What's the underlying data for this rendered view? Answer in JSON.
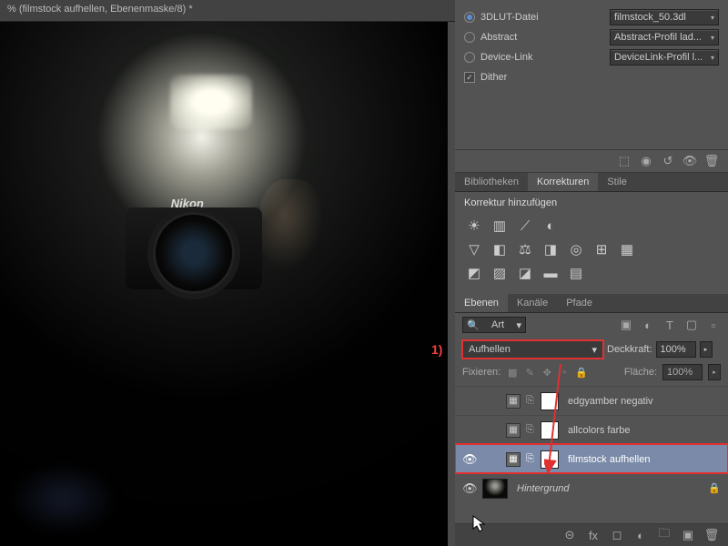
{
  "document": {
    "tab_title": "% (filmstock aufhellen, Ebenenmaske/8) *"
  },
  "camera_brand": "Nikon",
  "properties": {
    "lut": {
      "label": "3DLUT-Datei",
      "value": "filmstock_50.3dl"
    },
    "abstract": {
      "label": "Abstract",
      "value": "Abstract-Profil lad..."
    },
    "device": {
      "label": "Device-Link",
      "value": "DeviceLink-Profil l..."
    },
    "dither": {
      "label": "Dither",
      "checked": true
    }
  },
  "tabs_mid": {
    "bibliotheken": "Bibliotheken",
    "korrekturen": "Korrekturen",
    "stile": "Stile"
  },
  "adjustments": {
    "title": "Korrektur hinzufügen"
  },
  "tabs_layers": {
    "ebenen": "Ebenen",
    "kanaele": "Kanäle",
    "pfade": "Pfade"
  },
  "layers_top": {
    "filter": "Art"
  },
  "blend": {
    "mode": "Aufhellen",
    "opacity_label": "Deckkraft:",
    "opacity": "100%"
  },
  "lock": {
    "label": "Fixieren:",
    "fill_label": "Fläche:",
    "fill": "100%"
  },
  "layers": [
    {
      "name": "edgyamber negativ",
      "visible": false,
      "type": "adjustment"
    },
    {
      "name": "allcolors farbe",
      "visible": false,
      "type": "adjustment"
    },
    {
      "name": "filmstock aufhellen",
      "visible": true,
      "type": "adjustment",
      "selected": true
    },
    {
      "name": "Hintergrund",
      "visible": true,
      "type": "background",
      "locked": true
    }
  ],
  "annotation": {
    "one": "1)"
  }
}
